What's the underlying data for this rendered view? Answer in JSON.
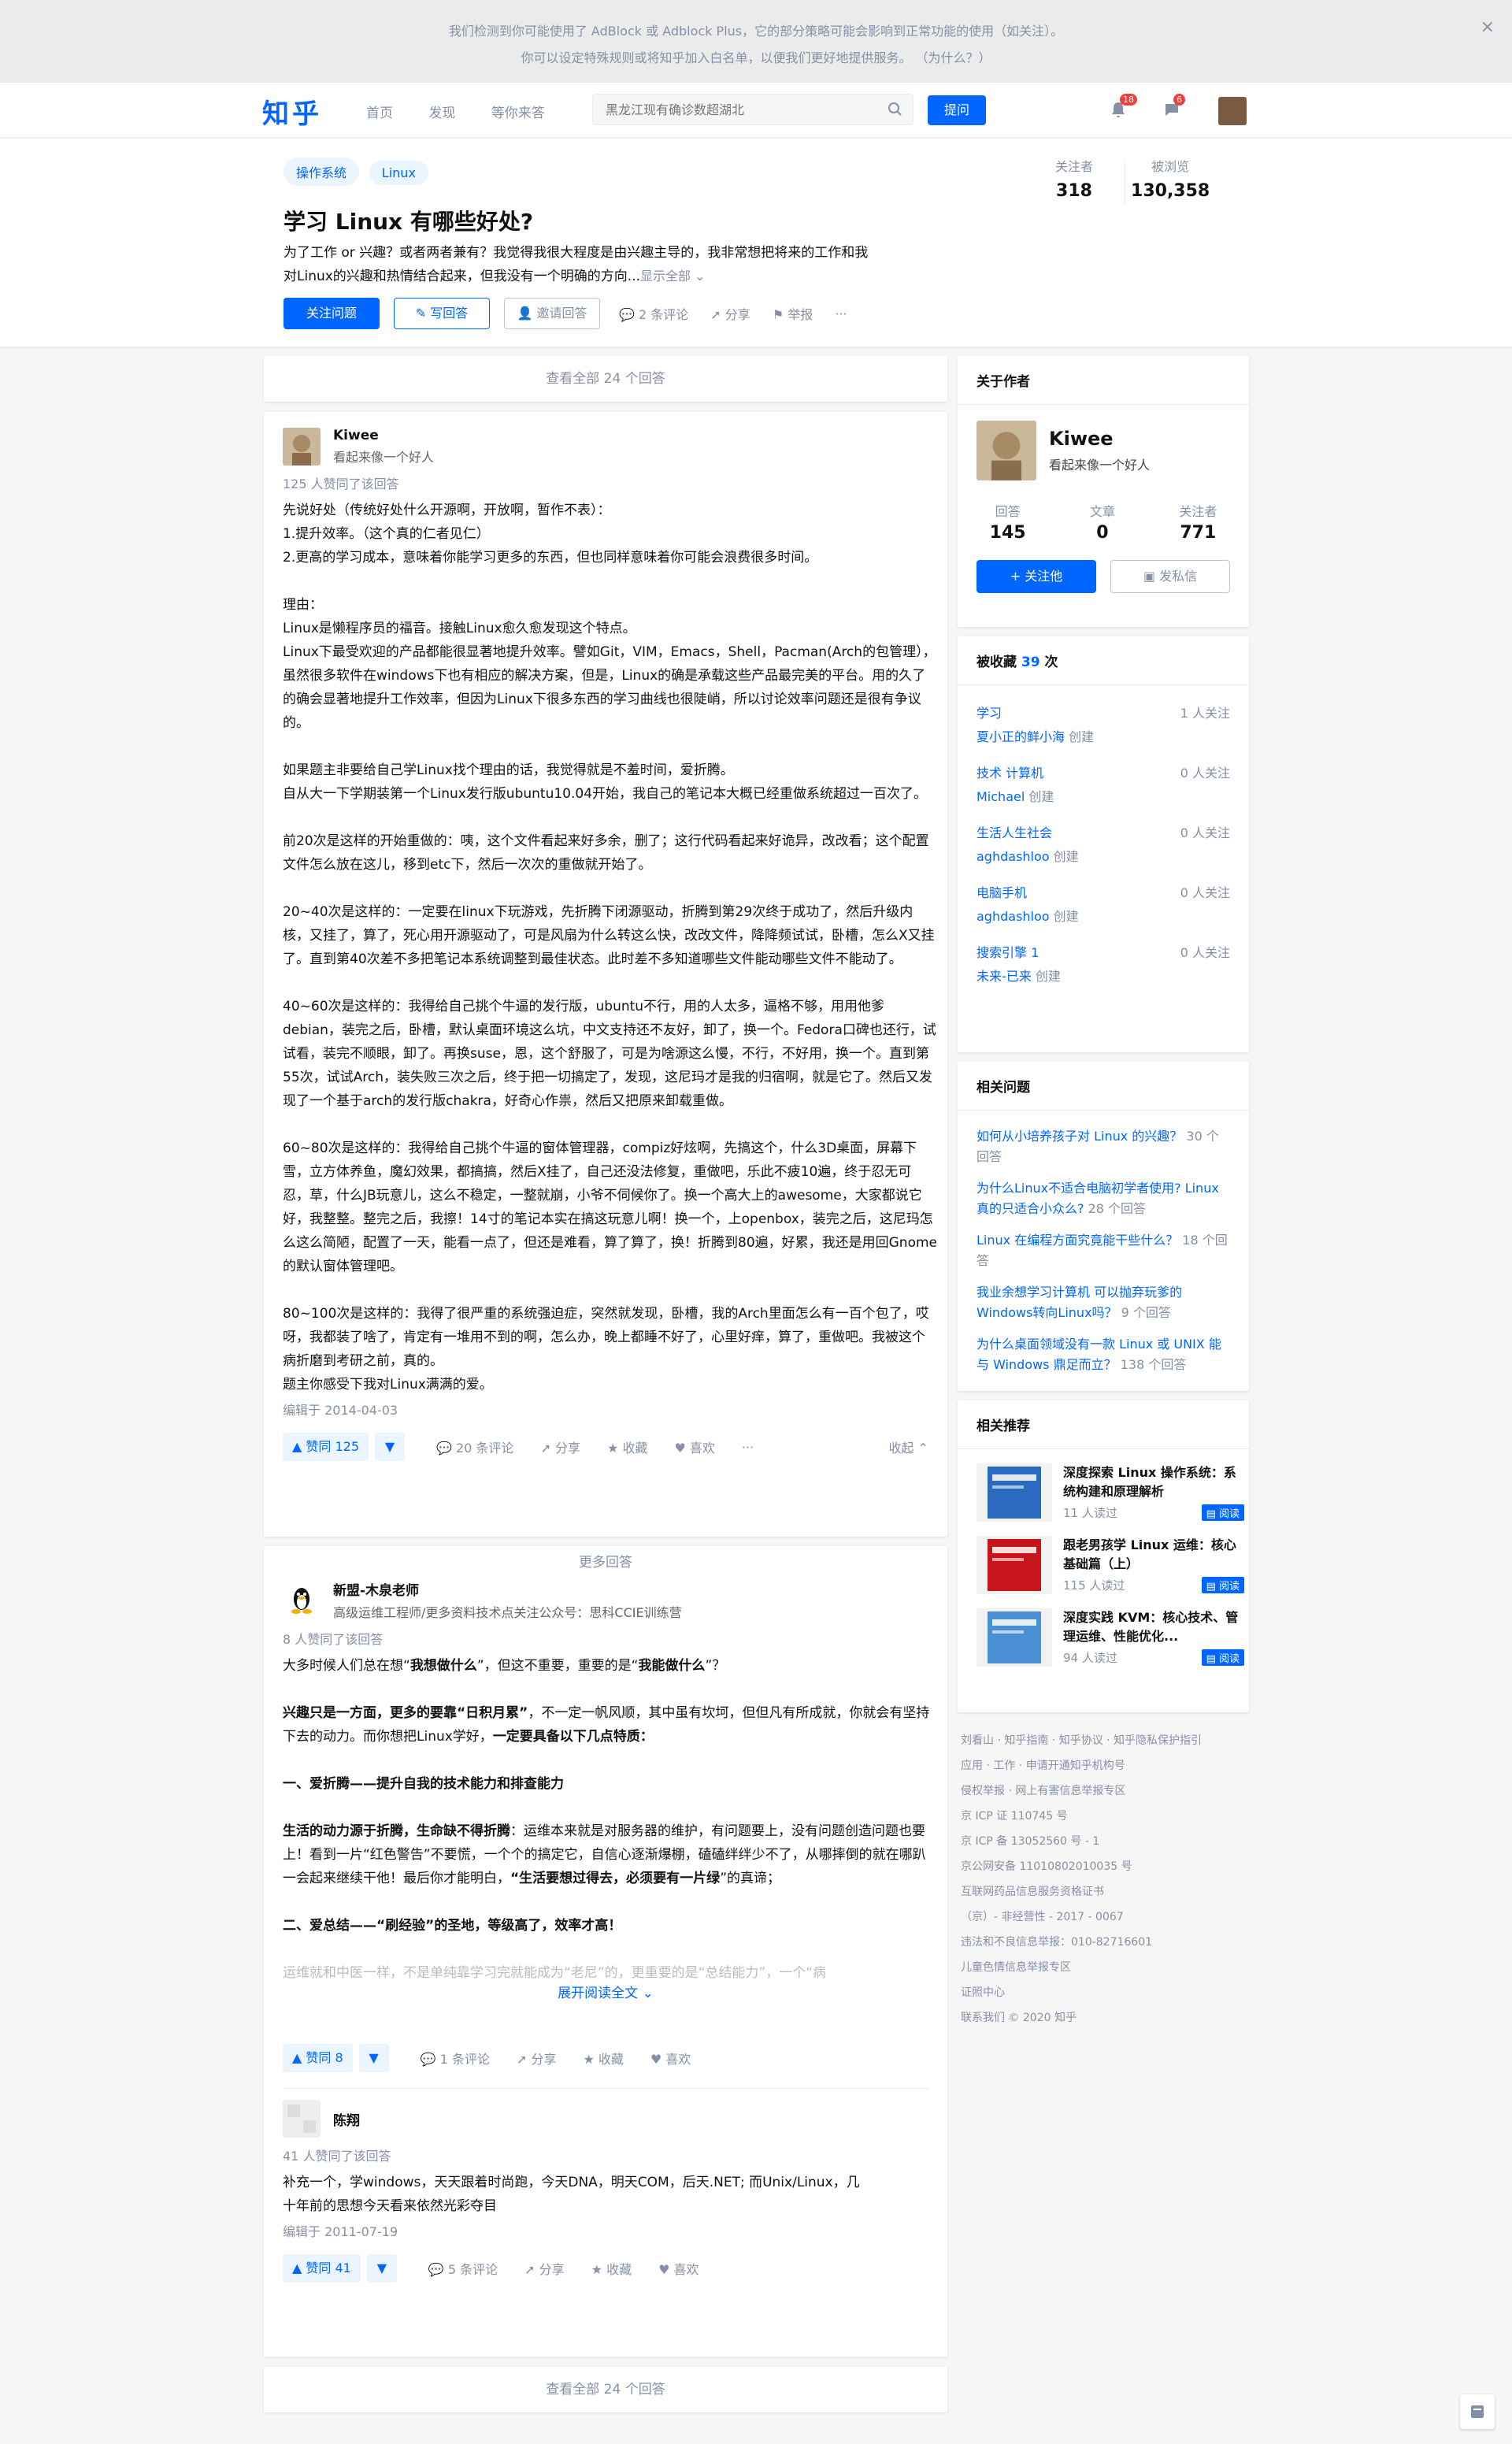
{
  "adblock": {
    "line1": "我们检测到你可能使用了 AdBlock 或 Adblock Plus，它的部分策略可能会影响到正常功能的使用（如关注）。",
    "line2": "你可以设定特殊规则或将知乎加入白名单，以便我们更好地提供服务。 （为什么？）",
    "close": "×"
  },
  "header": {
    "logo": "知乎",
    "nav": [
      "首页",
      "发现",
      "等你来答"
    ],
    "search_placeholder": "黑龙江现有确诊数超湖北",
    "ask_label": "提问",
    "notif_badge": "18",
    "msg_badge": "6"
  },
  "question": {
    "tags": [
      "操作系统",
      "Linux"
    ],
    "title": "学习 Linux 有哪些好处?",
    "desc_line1": "为了工作 or 兴趣？或者两者兼有？我觉得我很大程度是由兴趣主导的，我非常想把将来的工作和我",
    "desc_line2": "对Linux的兴趣和热情结合起来，但我没有一个明确的方向...",
    "show_all": "显示全部",
    "follow_btn": "关注问题",
    "write_btn": "写回答",
    "invite_btn": "邀请回答",
    "comments": "2 条评论",
    "share": "分享",
    "report": "举报",
    "more": "···",
    "followers_label": "关注者",
    "followers": "318",
    "views_label": "被浏览",
    "views": "130,358"
  },
  "view_all": "查看全部 24 个回答",
  "answers": [
    {
      "name": "Kiwee",
      "headline": "看起来像一个好人",
      "votes_line": "125 人赞同了该回答",
      "paragraphs": [
        "先说好处（传统好处什么开源啊，开放啊，暂作不表）：",
        "1.提升效率。（这个真的仁者见仁）",
        "2.更高的学习成本，意味着你能学习更多的东西，但也同样意味着你可能会浪费很多时间。",
        "",
        "理由：",
        "Linux是懒程序员的福音。接触Linux愈久愈发现这个特点。",
        "Linux下最受欢迎的产品都能很显著地提升效率。譬如Git，VIM，Emacs，Shell，Pacman(Arch的包管理），虽然很多软件在windows下也有相应的解决方案，但是，Linux的确是承载这些产品最完美的平台。用的久了的确会显著地提升工作效率，但因为Linux下很多东西的学习曲线也很陡峭，所以讨论效率问题还是很有争议的。",
        "",
        "如果题主非要给自己学Linux找个理由的话，我觉得就是不羞时间，爱折腾。",
        "自从大一下学期装第一个Linux发行版ubuntu10.04开始，我自己的笔记本大概已经重做系统超过一百次了。",
        "",
        "前20次是这样的开始重做的：咦，这个文件看起来好多余，删了；这行代码看起来好诡异，改改看；这个配置文件怎么放在这儿，移到etc下，然后一次次的重做就开始了。",
        "",
        "20~40次是这样的：一定要在linux下玩游戏，先折腾下闭源驱动，折腾到第29次终于成功了，然后升级内核，又挂了，算了，死心用开源驱动了，可是风扇为什么转这么快，改改文件，降降频试试，卧槽，怎么X又挂了。直到第40次差不多把笔记本系统调整到最佳状态。此时差不多知道哪些文件能动哪些文件不能动了。",
        "",
        "40~60次是这样的：我得给自己挑个牛逼的发行版，ubuntu不行，用的人太多，逼格不够，用用他爹debian，装完之后，卧槽，默认桌面环境这么坑，中文支持还不友好，卸了，换一个。Fedora口碑也还行，试试看，装完不顺眼，卸了。再换suse，恩，这个舒服了，可是为啥源这么慢，不行，不好用，换一个。直到第55次，试试Arch，装失败三次之后，终于把一切搞定了，发现，这尼玛才是我的归宿啊，就是它了。然后又发现了一个基于arch的发行版chakra，好奇心作祟，然后又把原来卸载重做。",
        "",
        "60~80次是这样的：我得给自己挑个牛逼的窗体管理器，compiz好炫啊，先搞这个，什么3D桌面，屏幕下雪，立方体养鱼，魔幻效果，都搞搞，然后X挂了，自己还没法修复，重做吧，乐此不疲10遍，终于忍无可忍，草，什么JB玩意儿，这么不稳定，一整就崩，小爷不伺候你了。换一个高大上的awesome，大家都说它好，我整整。整完之后，我擦！14寸的笔记本实在搞这玩意儿啊！换一个，上openbox，装完之后，这尼玛怎么这么简陋，配置了一天，能看一点了，但还是难看，算了算了，换！折腾到80遍，好累，我还是用回Gnome的默认窗体管理吧。",
        "",
        "80~100次是这样的：我得了很严重的系统强迫症，突然就发现，卧槽，我的Arch里面怎么有一百个包了，哎呀，我都装了啥了，肯定有一堆用不到的啊，怎么办，晚上都睡不好了，心里好痒，算了，重做吧。我被这个病折磨到考研之前，真的。",
        "题主你感受下我对Linux满满的爱。"
      ],
      "edited": "编辑于 2014-04-03",
      "vote_label": "▲ 赞同 125",
      "comments": "20 条评论",
      "share": "分享",
      "collect": "收藏",
      "like": "喜欢",
      "more": "···",
      "collapse": "收起 ⌃"
    },
    {
      "name": "新盟-木泉老师",
      "headline": "高级运维工程师/更多资料技术点关注公众号：思科CCIE训练营",
      "votes_line": "8 人赞同了该回答",
      "p1_pre": "大多时候人们总在想“",
      "p1_b1": "我想做什么",
      "p1_mid": "”，但这不重要，重要的是“",
      "p1_b2": "我能做什么",
      "p1_post": "”？",
      "p2_b": "兴趣只是一方面，更多的要靠“日积月累”",
      "p2_rest": "，不一定一帆风顺，其中虽有坎坷，但但凡有所成就，你就会有坚持下去的动力。而你想把Linux学好，",
      "p2_b2": "一定要具备以下几点特质：",
      "h1": "一、爱折腾——提升自我的技术能力和排查能力",
      "p3_b": "生活的动力源于折腾，生命缺不得折腾",
      "p3_rest": "：运维本来就是对服务器的维护，有问题要上，没有问题创造问题也要上！看到一片“红色警告”不要慌，一个个的搞定它，自信心逐渐爆棚，磕磕绊绊少不了，从哪摔倒的就在哪趴一会起来继续干他！最后你才能明白，",
      "p3_b2": "“生活要想过得去，必须要有一片绿",
      "p3_end": "”的真谛；",
      "h2": "二、爱总结——“刷经验”的圣地，等级高了，效率才高！",
      "faded": "运维就和中医一样，不是单纯靠学习完就能成为“老尼”的，更重要的是“总结能力”，一个“病",
      "expand": "展开阅读全文 ⌄",
      "vote_label": "▲ 赞同 8",
      "comments": "1 条评论",
      "share": "分享",
      "collect": "收藏",
      "like": "喜欢"
    },
    {
      "name": "陈翔",
      "votes_line": "41 人赞同了该回答",
      "line1": "补充一个，学windows，天天跟着时尚跑，今天DNA，明天COM，后天.NET; 而Unix/Linux，几",
      "line2": "十年前的思想今天看来依然光彩夺目",
      "edited": "编辑于 2011-07-19",
      "vote_label": "▲ 赞同 41",
      "comments": "5 条评论",
      "share": "分享",
      "collect": "收藏",
      "like": "喜欢"
    }
  ],
  "more_answers": "更多回答",
  "view_all_bottom": "查看全部 24 个回答",
  "sidebar": {
    "about_title": "关于作者",
    "author_name": "Kiwee",
    "author_headline": "看起来像一个好人",
    "stats": [
      {
        "label": "回答",
        "value": "145"
      },
      {
        "label": "文章",
        "value": "0"
      },
      {
        "label": "关注者",
        "value": "771"
      }
    ],
    "follow_btn": "+ 关注他",
    "msg_btn": "发私信",
    "collected_title": "被收藏",
    "collected_count": "39",
    "collected_suffix": "次",
    "collections": [
      {
        "name": "学习",
        "creator": "夏小正的鲜小海",
        "follow": "1 人关注"
      },
      {
        "name": "技术 计算机",
        "creator": "Michael",
        "follow": "0 人关注"
      },
      {
        "name": "生活人生社会",
        "creator": "aghdashloo",
        "follow": "0 人关注"
      },
      {
        "name": "电脑手机",
        "creator": "aghdashloo",
        "follow": "0 人关注"
      },
      {
        "name": "搜索引擎 1",
        "creator": "未来-已来",
        "follow": "0 人关注"
      }
    ],
    "created_suffix": "创建",
    "related_title": "相关问题",
    "related": [
      {
        "q": "如何从小培养孩子对 Linux 的兴趣？",
        "c": "30 个回答"
      },
      {
        "q": "为什么Linux不适合电脑初学者使用? Linux真的只适合小众么?",
        "c": "28 个回答"
      },
      {
        "q": "Linux 在编程方面究竟能干些什么？",
        "c": "18 个回答"
      },
      {
        "q": "我业余想学习计算机 可以抛弃玩爹的Windows转向Linux吗？",
        "c": "9 个回答"
      },
      {
        "q": "为什么桌面领域没有一款 Linux 或 UNIX 能与 Windows 鼎足而立？",
        "c": "138 个回答"
      }
    ],
    "rec_title": "相关推荐",
    "recs": [
      {
        "t": "深度探索 Linux 操作系统：系统构建和原理解析",
        "r": "11 人读过",
        "btn": "阅读",
        "cover": "#2a6bbf"
      },
      {
        "t": "跟老男孩学 Linux 运维：核心基础篇（上）",
        "r": "115 人读过",
        "btn": "阅读",
        "cover": "#c7151c"
      },
      {
        "t": "深度实践 KVM：核心技术、管理运维、性能优化...",
        "r": "94 人读过",
        "btn": "阅读",
        "cover": "#4a8ed4"
      }
    ]
  },
  "footer": [
    "刘看山 · 知乎指南 · 知乎协议 · 知乎隐私保护指引",
    "应用 · 工作 · 申请开通知乎机构号",
    "侵权举报 · 网上有害信息举报专区",
    "京 ICP 证 110745 号",
    "京 ICP 备 13052560 号 - 1",
    "京公网安备 11010802010035 号",
    "互联网药品信息服务资格证书",
    "（京）- 非经营性 - 2017 - 0067",
    "违法和不良信息举报：010-82716601",
    "儿童色情信息举报专区",
    "证照中心",
    "联系我们 © 2020 知乎"
  ]
}
